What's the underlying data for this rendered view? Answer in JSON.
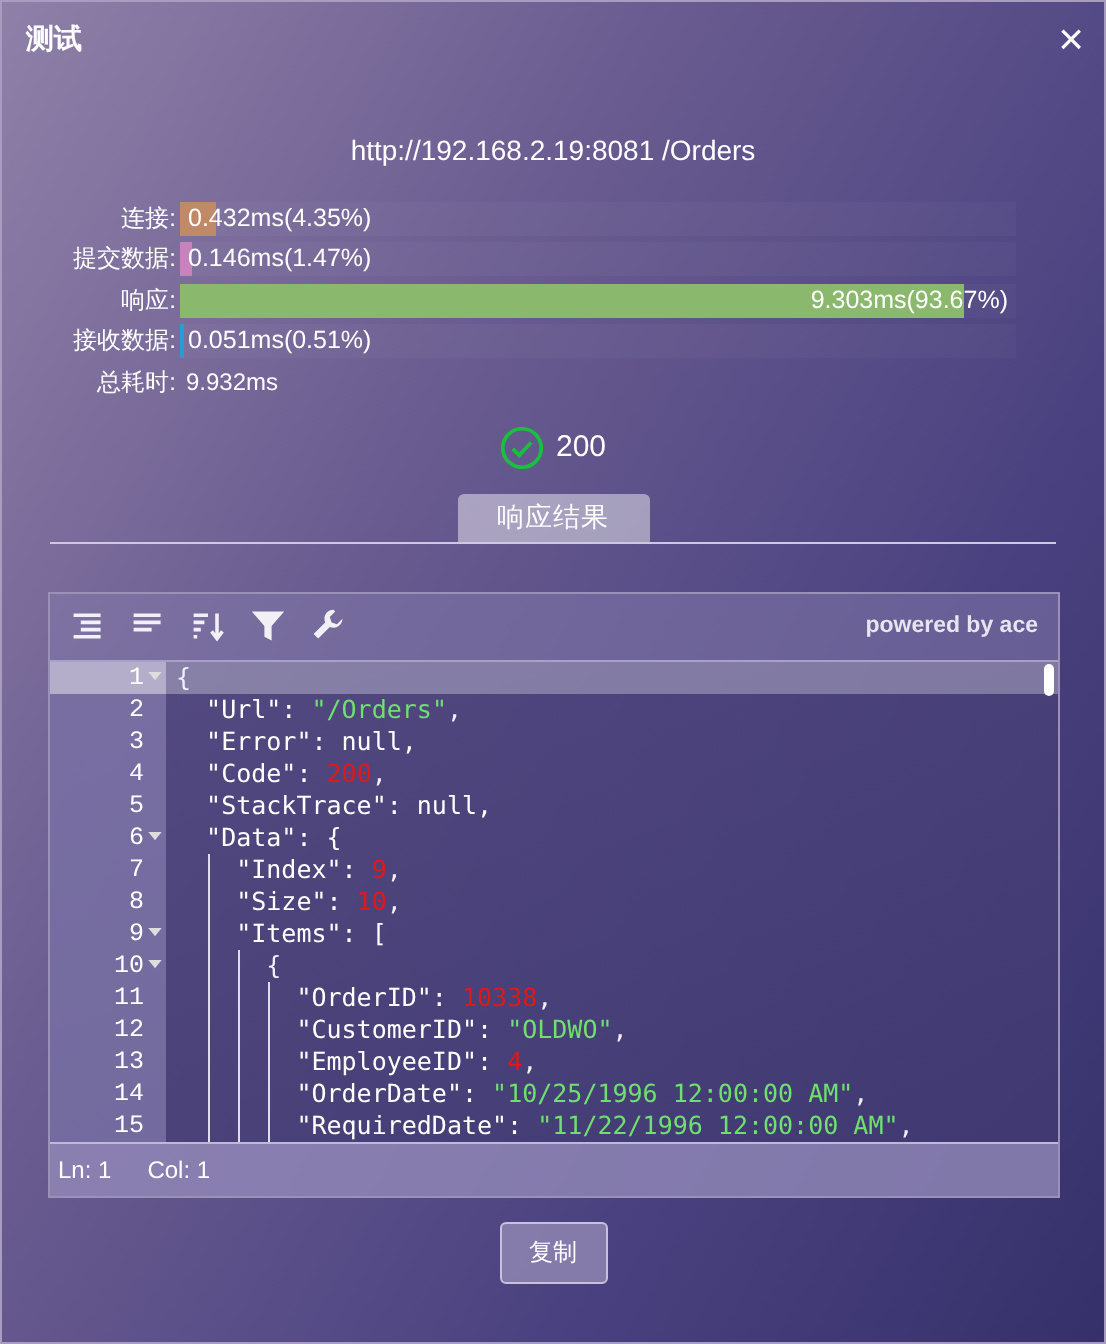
{
  "dialog": {
    "title": "测试",
    "close": "×"
  },
  "url": "http://192.168.2.19:8081 /Orders",
  "timings": [
    {
      "label": "连接:",
      "reading": "0.432ms(4.35%)",
      "level": 0.0435,
      "color": "#c08a68"
    },
    {
      "label": "提交数据:",
      "reading": "0.146ms(1.47%)",
      "level": 0.0147,
      "color": "#c882bc"
    },
    {
      "label": "响应:",
      "reading": "9.303ms(93.67%)",
      "level": 0.9367,
      "color": "#8ab86c"
    },
    {
      "label": "接收数据:",
      "reading": "0.051ms(0.51%)",
      "level": 0.0051,
      "color": "#2b9bd2"
    }
  ],
  "total": {
    "label": "总耗时:",
    "value": "9.932ms"
  },
  "status": {
    "code": "200",
    "ok": true
  },
  "tabs": [
    {
      "label": "响应结果",
      "selected": true
    }
  ],
  "editor": {
    "powered_by": "powered by ace",
    "lines": [
      {
        "number": "1",
        "foldable": true,
        "current": true,
        "tokens": [
          {
            "kind": "punct",
            "text": "{"
          }
        ],
        "children": [
          {
            "number": "2",
            "foldable": false,
            "current": false,
            "tokens": [
              {
                "kind": "key",
                "text": "\"Url\": "
              },
              {
                "kind": "string",
                "text": "\"/Orders\""
              },
              {
                "kind": "punct",
                "text": ","
              }
            ]
          },
          {
            "number": "3",
            "foldable": false,
            "current": false,
            "tokens": [
              {
                "kind": "key",
                "text": "\"Error\": null,"
              }
            ]
          },
          {
            "number": "4",
            "foldable": false,
            "current": false,
            "tokens": [
              {
                "kind": "key",
                "text": "\"Code\": "
              },
              {
                "kind": "number",
                "text": "200"
              },
              {
                "kind": "punct",
                "text": ","
              }
            ]
          },
          {
            "number": "5",
            "foldable": false,
            "current": false,
            "tokens": [
              {
                "kind": "key",
                "text": "\"StackTrace\": null,"
              }
            ]
          },
          {
            "number": "6",
            "foldable": true,
            "current": false,
            "tokens": [
              {
                "kind": "key",
                "text": "\"Data\": {"
              }
            ],
            "children": [
              {
                "number": "7",
                "foldable": false,
                "current": false,
                "tokens": [
                  {
                    "kind": "key",
                    "text": "\"Index\": "
                  },
                  {
                    "kind": "number",
                    "text": "9"
                  },
                  {
                    "kind": "punct",
                    "text": ","
                  }
                ]
              },
              {
                "number": "8",
                "foldable": false,
                "current": false,
                "tokens": [
                  {
                    "kind": "key",
                    "text": "\"Size\": "
                  },
                  {
                    "kind": "number",
                    "text": "10"
                  },
                  {
                    "kind": "punct",
                    "text": ","
                  }
                ]
              },
              {
                "number": "9",
                "foldable": true,
                "current": false,
                "tokens": [
                  {
                    "kind": "key",
                    "text": "\"Items\": ["
                  }
                ],
                "children": [
                  {
                    "number": "10",
                    "foldable": true,
                    "current": false,
                    "tokens": [
                      {
                        "kind": "punct",
                        "text": "{"
                      }
                    ],
                    "children": [
                      {
                        "number": "11",
                        "foldable": false,
                        "current": false,
                        "tokens": [
                          {
                            "kind": "key",
                            "text": "\"OrderID\": "
                          },
                          {
                            "kind": "number",
                            "text": "10338"
                          },
                          {
                            "kind": "punct",
                            "text": ","
                          }
                        ]
                      },
                      {
                        "number": "12",
                        "foldable": false,
                        "current": false,
                        "tokens": [
                          {
                            "kind": "key",
                            "text": "\"CustomerID\": "
                          },
                          {
                            "kind": "string",
                            "text": "\"OLDWO\""
                          },
                          {
                            "kind": "punct",
                            "text": ","
                          }
                        ]
                      },
                      {
                        "number": "13",
                        "foldable": false,
                        "current": false,
                        "tokens": [
                          {
                            "kind": "key",
                            "text": "\"EmployeeID\": "
                          },
                          {
                            "kind": "number",
                            "text": "4"
                          },
                          {
                            "kind": "punct",
                            "text": ","
                          }
                        ]
                      },
                      {
                        "number": "14",
                        "foldable": false,
                        "current": false,
                        "tokens": [
                          {
                            "kind": "key",
                            "text": "\"OrderDate\": "
                          },
                          {
                            "kind": "string",
                            "text": "\"10/25/1996 12:00:00 AM\""
                          },
                          {
                            "kind": "punct",
                            "text": ","
                          }
                        ]
                      },
                      {
                        "number": "15",
                        "foldable": false,
                        "current": false,
                        "tokens": [
                          {
                            "kind": "key",
                            "text": "\"RequiredDate\": "
                          },
                          {
                            "kind": "string",
                            "text": "\"11/22/1996 12:00:00 AM\""
                          },
                          {
                            "kind": "punct",
                            "text": ","
                          }
                        ]
                      }
                    ]
                  }
                ]
              }
            ]
          }
        ]
      }
    ],
    "position": [
      {
        "label": "Ln: 1"
      },
      {
        "label": "Col: 1"
      }
    ]
  },
  "copy_button": "复制"
}
